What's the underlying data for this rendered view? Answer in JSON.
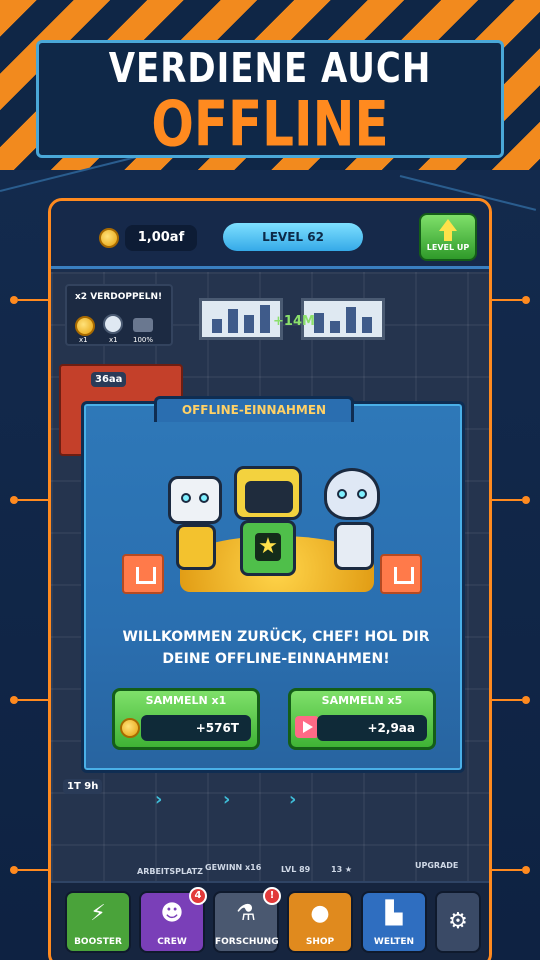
{
  "banner": {
    "line1": "VERDIENE AUCH",
    "line2": "OFFLINE"
  },
  "topbar": {
    "money": "1,00af",
    "level": "LEVEL 62",
    "levelup_label": "LEVEL UP"
  },
  "factory": {
    "boost_title": "x2 VERDOPPELN!",
    "boost_values": [
      "x1",
      "x1",
      "100%"
    ],
    "plus_income": "+14M",
    "badge_36aa": "36aa",
    "badge_time": "1T 9h",
    "row_labels": {
      "workplace": "ARBEITSPLATZ",
      "profit": "GEWINN x16",
      "level": "LVL 89",
      "stars": "13",
      "upgrade": "UPGRADE"
    }
  },
  "modal": {
    "title": "OFFLINE-EINNAHMEN",
    "message_line1": "WILLKOMMEN ZURÜCK, CHEF! HOL DIR",
    "message_line2": "DEINE OFFLINE-EINNAHMEN!",
    "collect1": {
      "label": "SAMMELN x1",
      "value": "+576T"
    },
    "collect5": {
      "label": "SAMMELN x5",
      "value": "+2,9aa"
    }
  },
  "nav": [
    {
      "label": "BOOSTER",
      "icon": "lightning-icon",
      "color": "#4aa33a",
      "badge": ""
    },
    {
      "label": "CREW",
      "icon": "robot-icon",
      "color": "#7a3fb8",
      "badge": "4"
    },
    {
      "label": "FORSCHUNG",
      "icon": "flask-icon",
      "color": "#4a5870",
      "badge": "!"
    },
    {
      "label": "SHOP",
      "icon": "coins-icon",
      "color": "#e08a1e",
      "badge": ""
    },
    {
      "label": "WELTEN",
      "icon": "factory-icon",
      "color": "#2f6ec0",
      "badge": ""
    },
    {
      "label": "",
      "icon": "gear-icon",
      "color": "#3a4a66",
      "badge": ""
    }
  ],
  "colors": {
    "accent": "#ff8a1f",
    "green": "#3fb335",
    "blue": "#2a6fb0"
  }
}
